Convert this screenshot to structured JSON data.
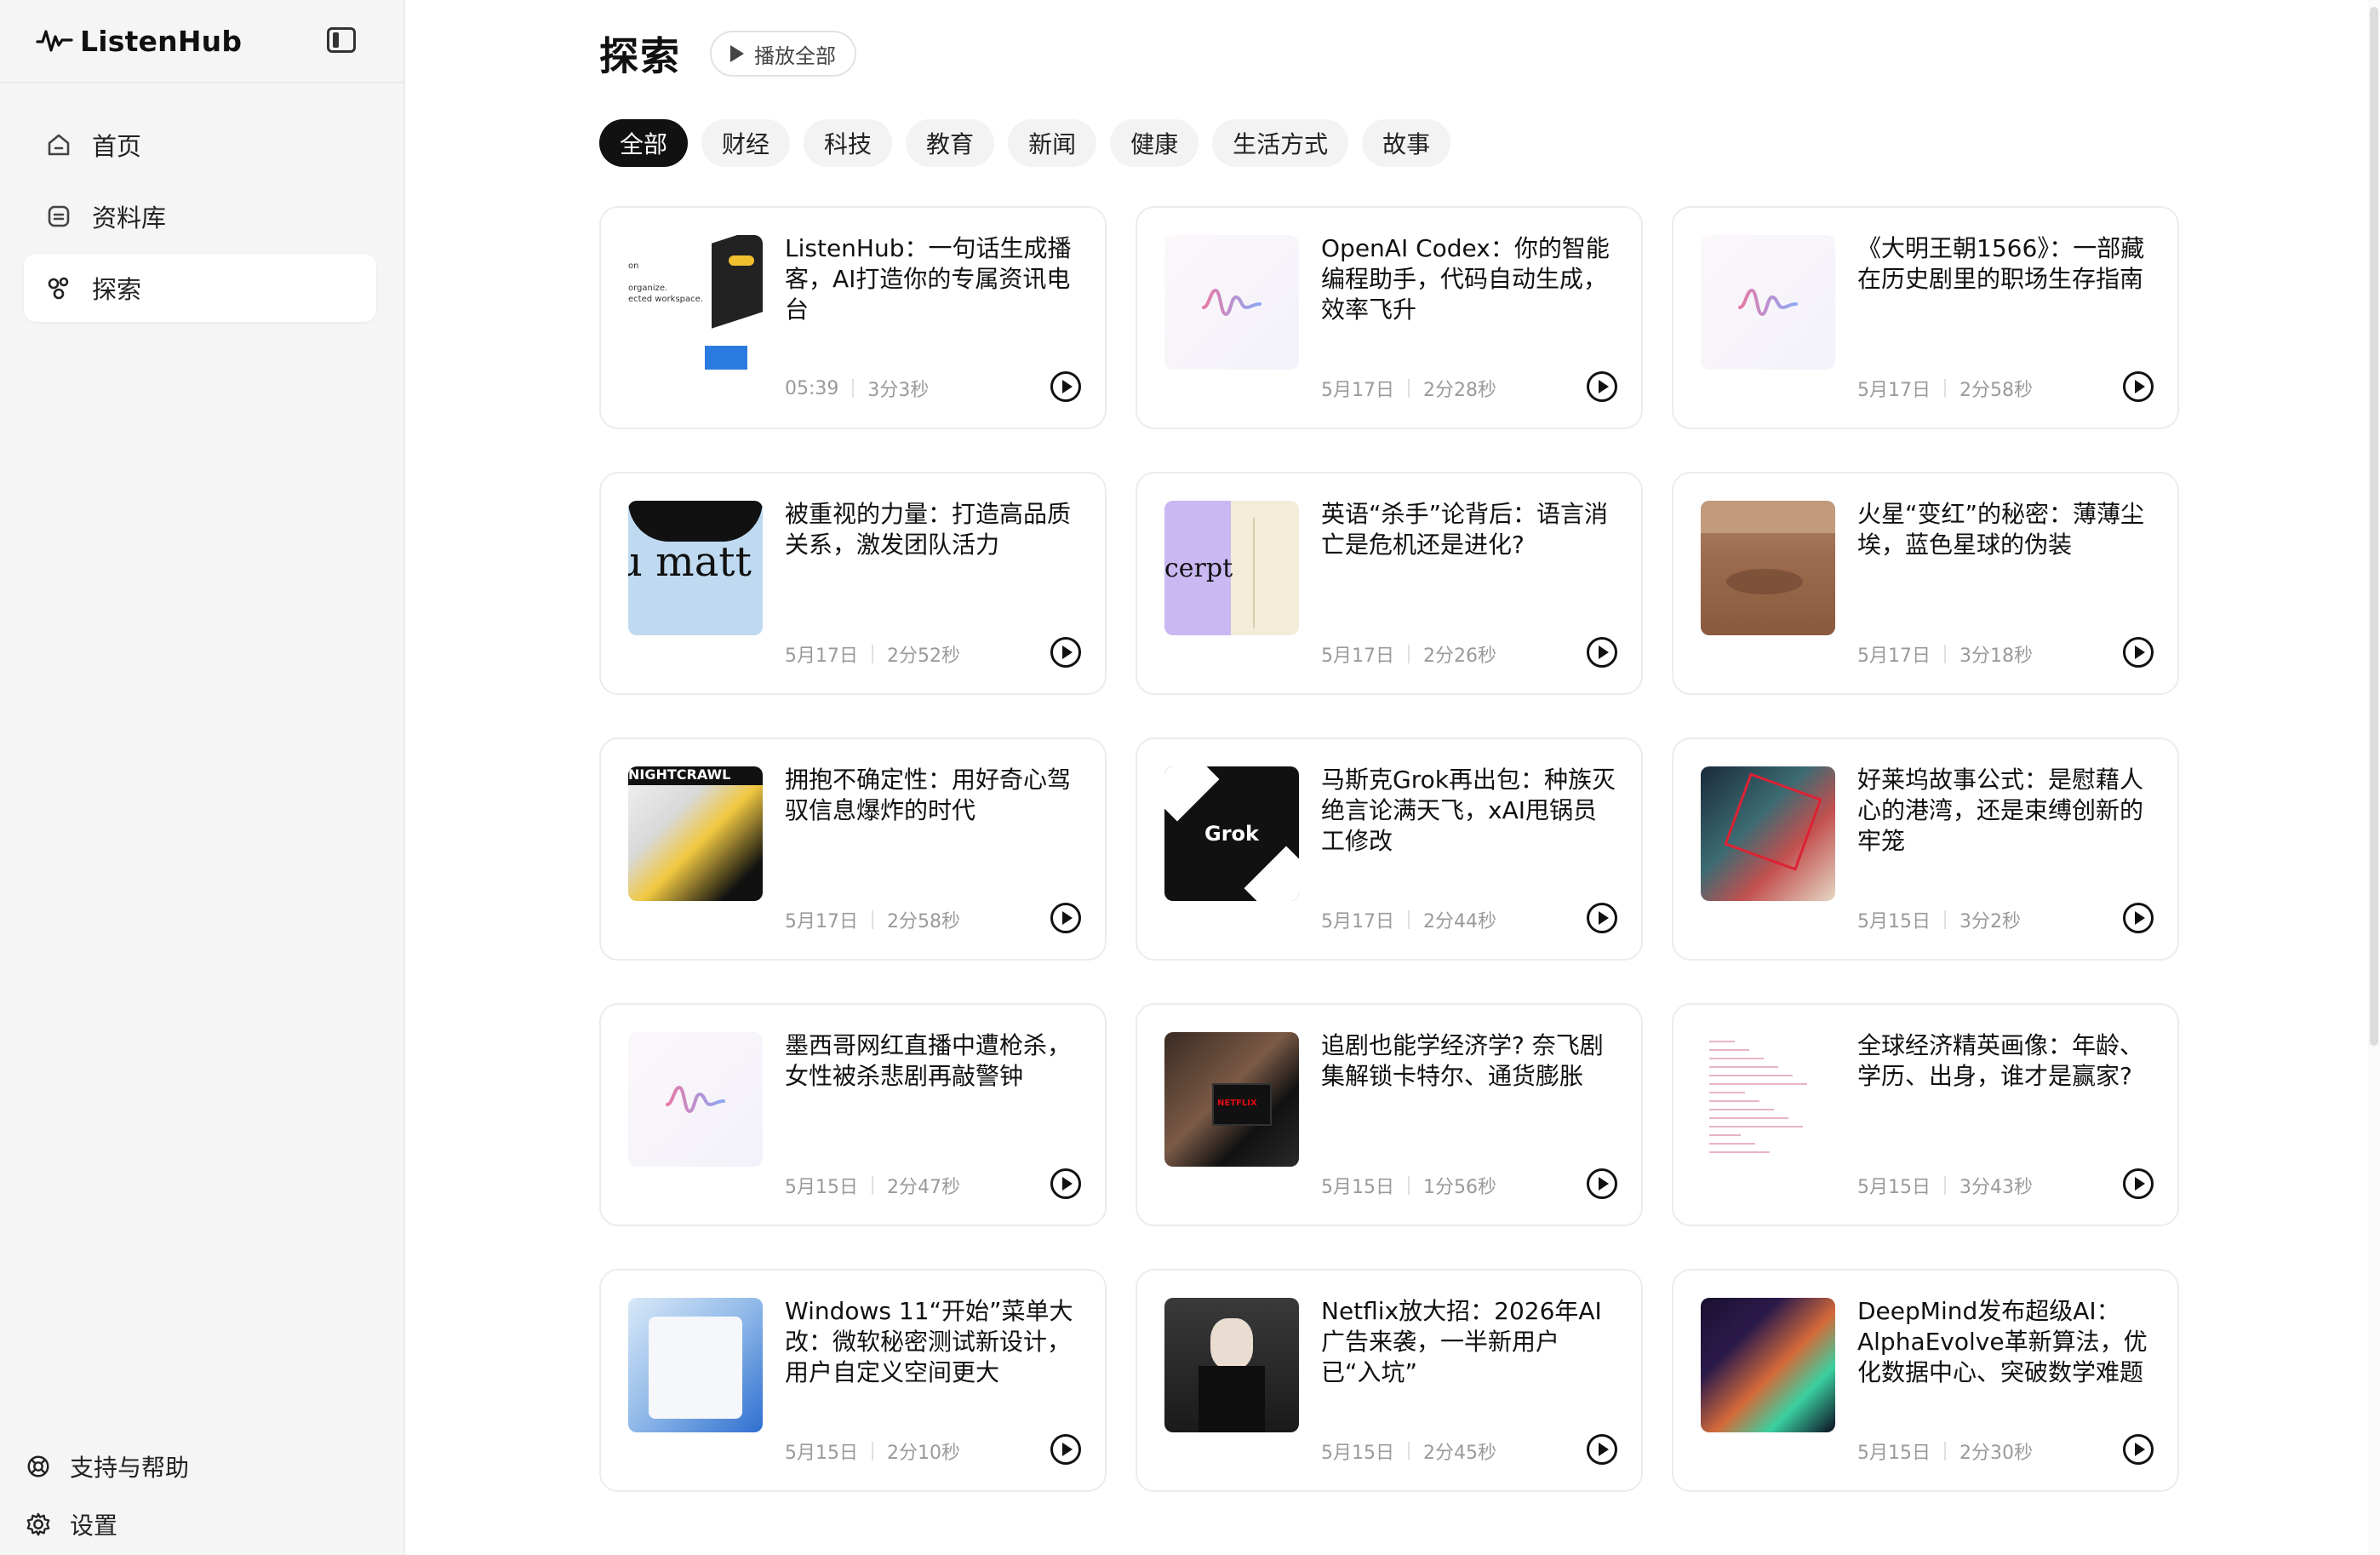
{
  "app": {
    "name": "ListenHub"
  },
  "sidebar": {
    "nav": [
      {
        "label": "首页",
        "icon": "home-icon",
        "active": false
      },
      {
        "label": "资料库",
        "icon": "library-icon",
        "active": false
      },
      {
        "label": "探索",
        "icon": "explore-icon",
        "active": true
      }
    ],
    "bottom": [
      {
        "label": "支持与帮助",
        "icon": "lifebuoy-icon"
      },
      {
        "label": "设置",
        "icon": "gear-icon"
      }
    ]
  },
  "main": {
    "title": "探索",
    "play_all": "播放全部",
    "tabs": [
      "全部",
      "财经",
      "科技",
      "教育",
      "新闻",
      "健康",
      "生活方式",
      "故事"
    ],
    "active_tab": 0,
    "cards": [
      {
        "title": "ListenHub：一句话生成播客，AI打造你的专属资讯电台",
        "date": "05:39",
        "duration": "3分3秒",
        "thumb": "ui"
      },
      {
        "title": "OpenAI Codex：你的智能编程助手，代码自动生成，效率飞升",
        "date": "5月17日",
        "duration": "2分28秒",
        "thumb": "logo"
      },
      {
        "title": "《大明王朝1566》：一部藏在历史剧里的职场生存指南",
        "date": "5月17日",
        "duration": "2分58秒",
        "thumb": "logo"
      },
      {
        "title": "被重视的力量：打造高品质关系，激发团队活力",
        "date": "5月17日",
        "duration": "2分52秒",
        "thumb": "blue"
      },
      {
        "title": "英语“杀手”论背后：语言消亡是危机还是进化?",
        "date": "5月17日",
        "duration": "2分26秒",
        "thumb": "book"
      },
      {
        "title": "火星“变红”的秘密：薄薄尘埃，蓝色星球的伪装",
        "date": "5月17日",
        "duration": "3分18秒",
        "thumb": "mars"
      },
      {
        "title": "拥抱不确定性：用好奇心驾驭信息爆炸的时代",
        "date": "5月17日",
        "duration": "2分58秒",
        "thumb": "news"
      },
      {
        "title": "马斯克Grok再出包：种族灭绝言论满天飞，xAI甩锅员工修改",
        "date": "5月17日",
        "duration": "2分44秒",
        "thumb": "grok"
      },
      {
        "title": "好莱坞故事公式：是慰藉人心的港湾，还是束缚创新的牢笼",
        "date": "5月15日",
        "duration": "3分2秒",
        "thumb": "film"
      },
      {
        "title": "墨西哥网红直播中遭枪杀，女性被杀悲剧再敲警钟",
        "date": "5月15日",
        "duration": "2分47秒",
        "thumb": "logo"
      },
      {
        "title": "追剧也能学经济学? 奈飞剧集解锁卡特尔、通货膨胀",
        "date": "5月15日",
        "duration": "1分56秒",
        "thumb": "netflix"
      },
      {
        "title": "全球经济精英画像：年龄、学历、出身，谁才是赢家?",
        "date": "5月15日",
        "duration": "3分43秒",
        "thumb": "chart"
      },
      {
        "title": "Windows 11“开始”菜单大改：微软秘密测试新设计，用户自定义空间更大",
        "date": "5月15日",
        "duration": "2分10秒",
        "thumb": "win"
      },
      {
        "title": "Netflix放大招：2026年AI广告来袭，一半新用户已“入坑”",
        "date": "5月15日",
        "duration": "2分45秒",
        "thumb": "wed"
      },
      {
        "title": "DeepMind发布超级AI：AlphaEvolve革新算法，优化数据中心、突破数学难题",
        "date": "5月15日",
        "duration": "2分30秒",
        "thumb": "deep"
      }
    ]
  },
  "thumb_text": {
    "grok": "Grok",
    "netflix": "NETFLIX",
    "book_excerpt": "cerpt",
    "blue_word": "u matt",
    "night": "NIGHTCRAWL"
  },
  "colors": {
    "accent": "#111111",
    "brand_pink": "#e77aa8",
    "brand_blue": "#8fa7f5"
  }
}
